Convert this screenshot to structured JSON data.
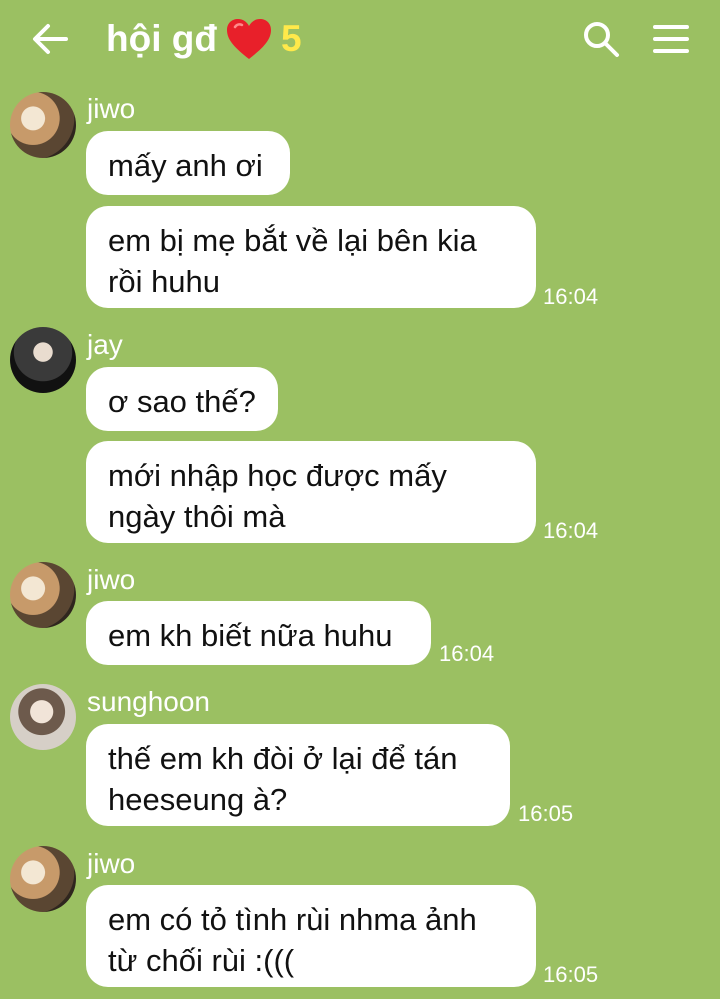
{
  "header": {
    "title": "hội gđ",
    "member_count": "5",
    "icons": [
      "back-arrow-icon",
      "heart-icon",
      "search-icon",
      "menu-icon"
    ]
  },
  "messages": [
    {
      "sender": "jiwo",
      "text": "mấy anh ơi",
      "time": ""
    },
    {
      "sender": "",
      "text": "em bị mẹ bắt về lại bên kia rồi huhu",
      "time": "16:04"
    },
    {
      "sender": "jay",
      "text": "ơ sao thế?",
      "time": ""
    },
    {
      "sender": "",
      "text": "mới nhập học được mấy ngày thôi mà",
      "time": "16:04"
    },
    {
      "sender": "jiwo",
      "text": "em kh biết nữa huhu",
      "time": "16:04"
    },
    {
      "sender": "sunghoon",
      "text": "thế em kh đòi ở lại để tán heeseung à?",
      "time": "16:05"
    },
    {
      "sender": "jiwo",
      "text": "em có tỏ tình rùi nhma ảnh từ chối rùi :(((",
      "time": "16:05"
    }
  ],
  "colors": {
    "background": "#9bc062",
    "bubble": "#ffffff",
    "heart": "#e8202a",
    "member_count": "#ffe94a"
  }
}
